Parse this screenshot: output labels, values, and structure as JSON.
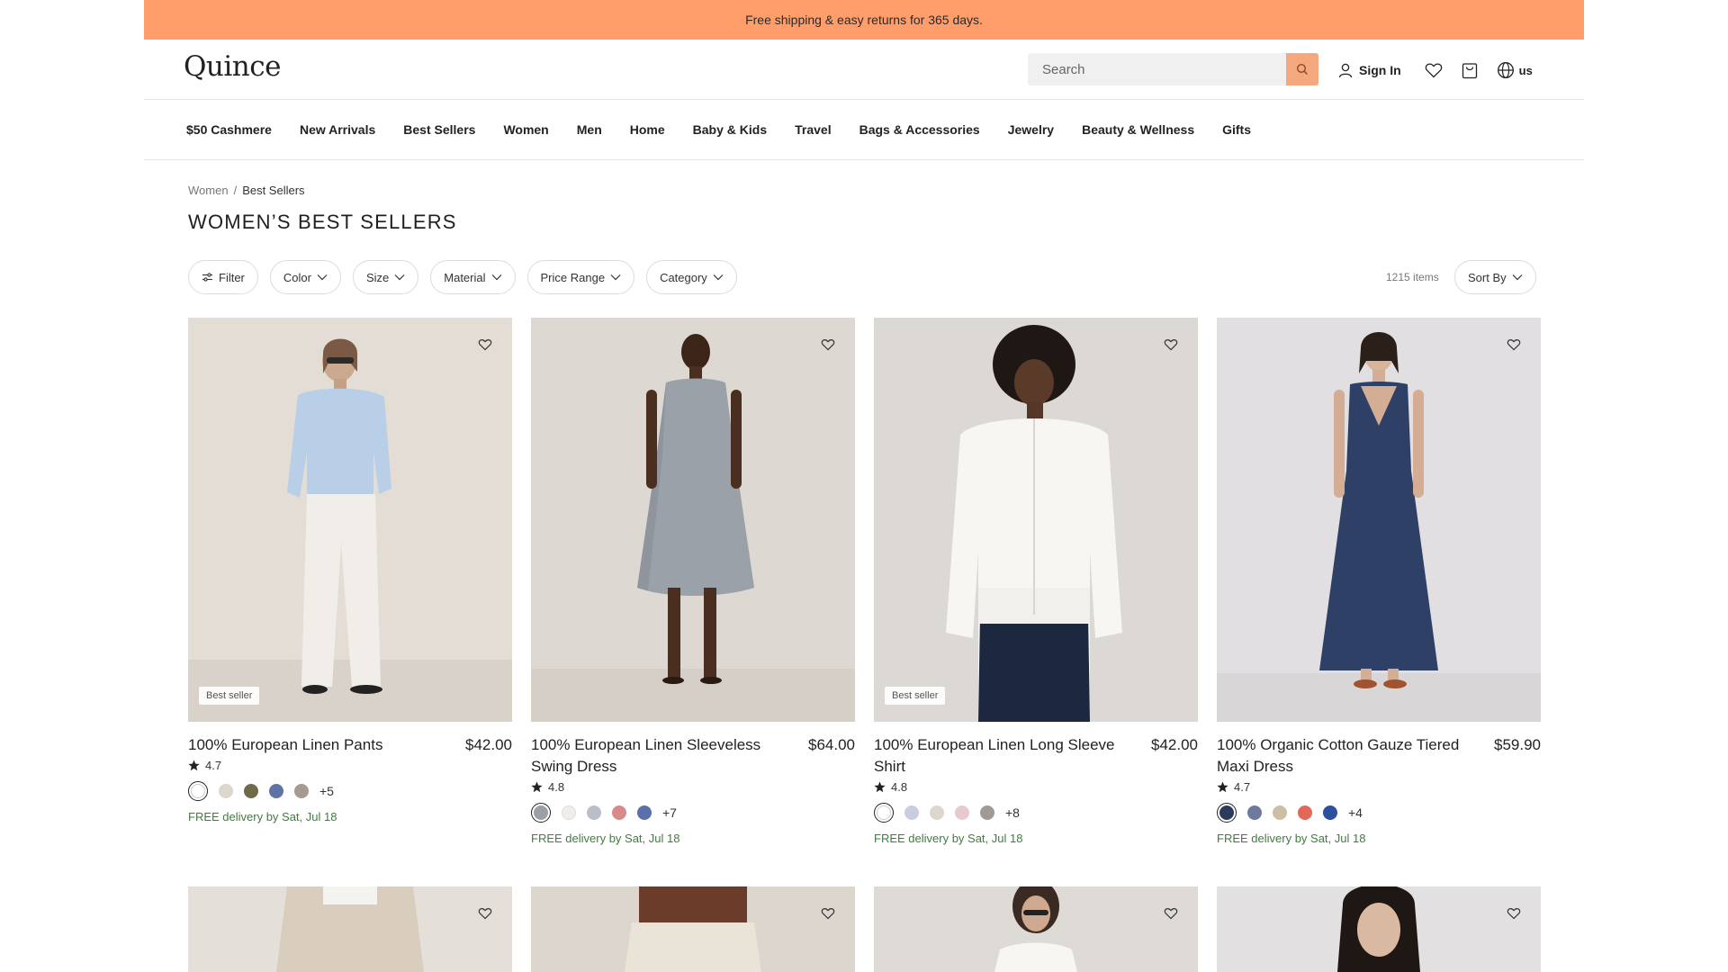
{
  "promo": {
    "text": "Free shipping & easy returns for 365 days."
  },
  "header": {
    "logo": "Quince",
    "search_placeholder": "Search",
    "sign_in": "Sign In",
    "locale": "us"
  },
  "nav": {
    "items": [
      "$50 Cashmere",
      "New Arrivals",
      "Best Sellers",
      "Women",
      "Men",
      "Home",
      "Baby & Kids",
      "Travel",
      "Bags & Accessories",
      "Jewelry",
      "Beauty & Wellness",
      "Gifts"
    ]
  },
  "breadcrumb": {
    "parent": "Women",
    "separator": "/",
    "current": "Best Sellers"
  },
  "page": {
    "title": "WOMEN’S BEST SELLERS"
  },
  "filters": {
    "filter": "Filter",
    "color": "Color",
    "size": "Size",
    "material": "Material",
    "price_range": "Price Range",
    "category": "Category",
    "items_count": "1215 items",
    "sort": "Sort By"
  },
  "products": [
    {
      "name": "100% European Linen Pants",
      "price": "$42.00",
      "rating": "4.7",
      "badge": "Best seller",
      "delivery": "FREE delivery by Sat, Jul 18",
      "more": "+5",
      "swatches": [
        "#ffffff",
        "#ddd6cc",
        "#6f6a4a",
        "#5f74a6",
        "#a39a94"
      ]
    },
    {
      "name": "100% European Linen Sleeveless Swing Dress",
      "price": "$64.00",
      "rating": "4.8",
      "badge": "",
      "delivery": "FREE delivery by Sat, Jul 18",
      "more": "+7",
      "swatches": [
        "#9aa0a6",
        "#f1eee9",
        "#b9bec7",
        "#d98b8b",
        "#5b6fa8"
      ]
    },
    {
      "name": "100% European Linen Long Sleeve Shirt",
      "price": "$42.00",
      "rating": "4.8",
      "badge": "Best seller",
      "delivery": "FREE delivery by Sat, Jul 18",
      "more": "+8",
      "swatches": [
        "#ffffff",
        "#c9cde0",
        "#ddd6cc",
        "#e8c9cf",
        "#a09994"
      ]
    },
    {
      "name": "100% Organic Cotton Gauze Tiered Maxi Dress",
      "price": "$59.90",
      "rating": "4.7",
      "badge": "",
      "delivery": "FREE delivery by Sat, Jul 18",
      "more": "+4",
      "swatches": [
        "#2c3a5c",
        "#6d7a9e",
        "#cbbfa6",
        "#e2685a",
        "#2c4f9e"
      ]
    }
  ],
  "colors": {
    "promo": "#ff9e6b",
    "search_button": "#f5a77d",
    "delivery": "#3f7d3f"
  }
}
